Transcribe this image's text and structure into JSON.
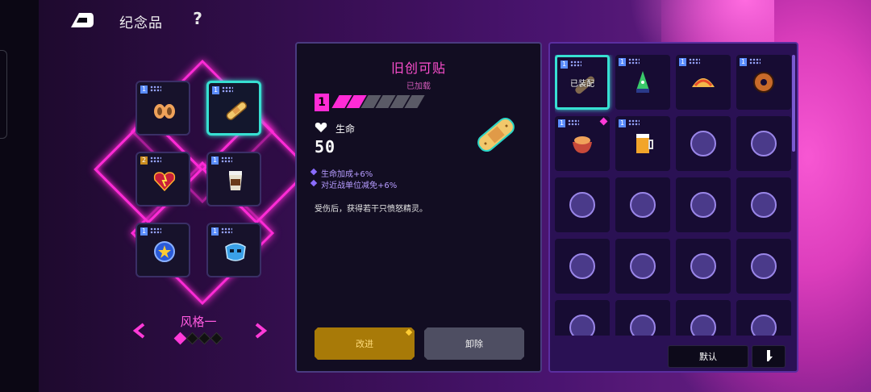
{
  "header": {
    "title": "纪念品",
    "help_label": "?"
  },
  "loadout": {
    "slots": [
      {
        "icon": "hands-icon",
        "level": "1",
        "selected": false
      },
      {
        "icon": "bandage-icon",
        "level": "1",
        "selected": true
      },
      {
        "icon": "fire-heart-icon",
        "level": "2",
        "selected": false
      },
      {
        "icon": "coffee-cup-icon",
        "level": "1",
        "selected": false
      },
      {
        "icon": "police-badge-icon",
        "level": "1",
        "selected": false
      },
      {
        "icon": "blue-mask-icon",
        "level": "1",
        "selected": false
      }
    ],
    "style_name": "风格一",
    "style_page": 1,
    "style_pages": 4
  },
  "detail": {
    "name": "旧创可贴",
    "state": "已加载",
    "level": "1",
    "pips_filled": 2,
    "pips_total": 6,
    "stat_label": "生命",
    "stat_value": "50",
    "bonuses": [
      "生命加成+6%",
      "对近战单位减免+6%"
    ],
    "description": "受伤后，获得若干只愤怒精灵。",
    "upgrade_label": "改进",
    "remove_label": "卸除"
  },
  "inventory": {
    "equipped_tag": "已装配",
    "default_label": "默认",
    "items": [
      {
        "icon": "bandage-icon",
        "level": "1",
        "equipped": true,
        "new": false
      },
      {
        "icon": "drill-icon",
        "level": "1",
        "equipped": false,
        "new": false
      },
      {
        "icon": "taco-icon",
        "level": "1",
        "equipped": false,
        "new": false
      },
      {
        "icon": "donut-icon",
        "level": "1",
        "equipped": false,
        "new": false
      },
      {
        "icon": "bowl-icon",
        "level": "1",
        "equipped": false,
        "new": true
      },
      {
        "icon": "beer-icon",
        "level": "1",
        "equipped": false,
        "new": false
      },
      {
        "icon": "locked-icon",
        "level": "",
        "equipped": false,
        "new": false
      },
      {
        "icon": "locked-icon",
        "level": "",
        "equipped": false,
        "new": false
      },
      {
        "icon": "locked-icon",
        "level": "",
        "equipped": false,
        "new": false
      },
      {
        "icon": "locked-icon",
        "level": "",
        "equipped": false,
        "new": false
      },
      {
        "icon": "locked-icon",
        "level": "",
        "equipped": false,
        "new": false
      },
      {
        "icon": "locked-icon",
        "level": "",
        "equipped": false,
        "new": false
      },
      {
        "icon": "locked-icon",
        "level": "",
        "equipped": false,
        "new": false
      },
      {
        "icon": "locked-icon",
        "level": "",
        "equipped": false,
        "new": false
      },
      {
        "icon": "locked-icon",
        "level": "",
        "equipped": false,
        "new": false
      },
      {
        "icon": "locked-icon",
        "level": "",
        "equipped": false,
        "new": false
      },
      {
        "icon": "locked-icon",
        "level": "",
        "equipped": false,
        "new": false
      },
      {
        "icon": "locked-icon",
        "level": "",
        "equipped": false,
        "new": false
      },
      {
        "icon": "locked-icon",
        "level": "",
        "equipped": false,
        "new": false
      },
      {
        "icon": "locked-icon",
        "level": "",
        "equipped": false,
        "new": false
      }
    ]
  },
  "colors": {
    "accent_pink": "#ff2bd6",
    "equipped_cyan": "#37e0d2",
    "upgrade_gold": "#a87a08",
    "panel_bg": "#120d22",
    "inventory_bg": "#2a1154"
  }
}
